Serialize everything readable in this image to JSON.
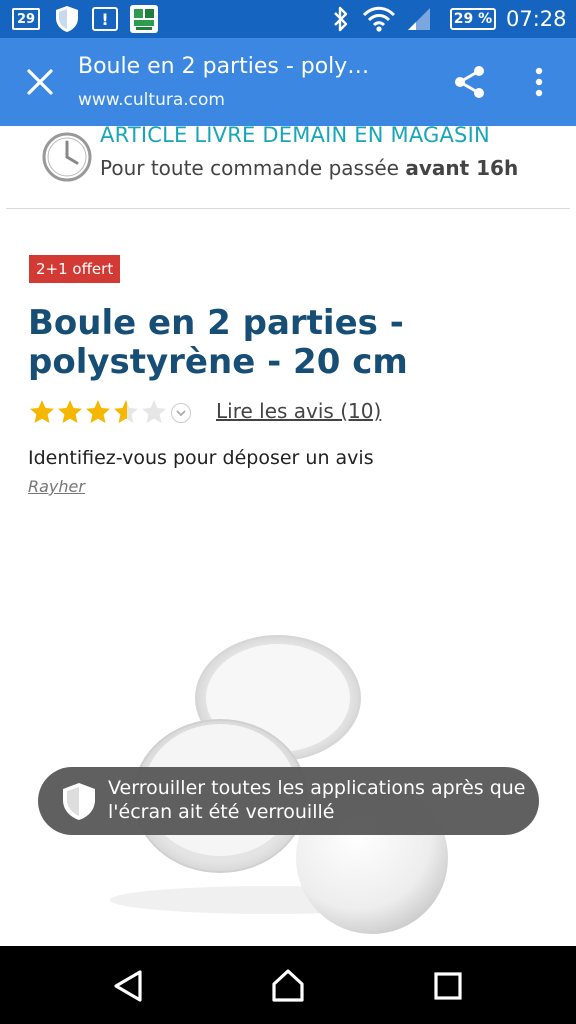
{
  "status_bar": {
    "calendar_day": "29",
    "battery_percent": "29 %",
    "time": "07:28",
    "icons": [
      "calendar-icon",
      "shield-icon",
      "alert-icon",
      "app-notification-icon",
      "bluetooth-icon",
      "wifi-icon",
      "signal-icon",
      "battery-icon"
    ]
  },
  "toolbar": {
    "title": "Boule en 2 parties - poly…",
    "url": "www.cultura.com",
    "close_icon": "close-icon",
    "share_icon": "share-icon",
    "more_icon": "more-vert-icon"
  },
  "promo": {
    "headline": "ARTICLE LIVRÉ DEMAIN EN MAGASIN",
    "sub_prefix": "Pour toute commande passée ",
    "sub_bold": "avant 16h"
  },
  "product": {
    "offer_badge": "2+1 offert",
    "title": "Boule en 2 parties - polystyrène - 20 cm",
    "rating_value": 3.5,
    "rating_max": 5,
    "reviews_link": "Lire les avis (10)",
    "login_prompt": "Identifiez-vous pour déposer un avis",
    "brand": "Rayher"
  },
  "toast": {
    "text": "Verrouiller toutes les applications après que l'écran ait été verrouillé"
  },
  "colors": {
    "status_bar": "#1565c0",
    "toolbar": "#3b87e2",
    "promo_headline": "#18a6b8",
    "title": "#174e75",
    "badge": "#d43a34",
    "star": "#f5b700",
    "toast": "#5b5b5b"
  }
}
